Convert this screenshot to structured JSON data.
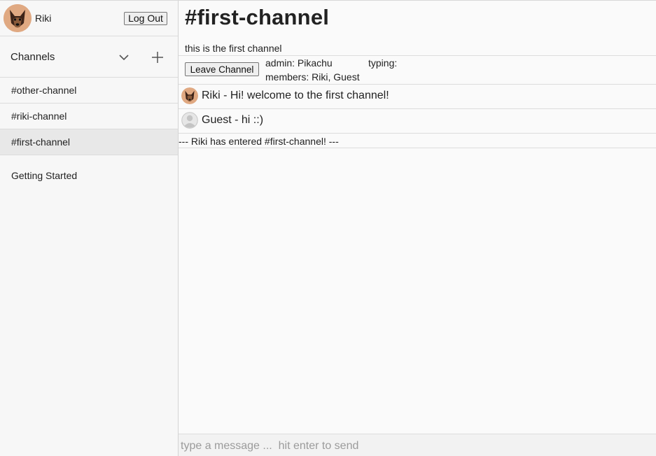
{
  "user": {
    "name": "Riki",
    "avatar_icon": "dog-avatar-icon"
  },
  "logout_label": "Log Out",
  "channels": {
    "title": "Channels",
    "items": [
      {
        "label": "#other-channel",
        "active": false
      },
      {
        "label": "#riki-channel",
        "active": false
      },
      {
        "label": "#first-channel",
        "active": true
      }
    ]
  },
  "getting_started": "Getting Started",
  "channel": {
    "title": "#first-channel",
    "description": "this is the first channel",
    "leave_label": "Leave Channel",
    "admin": "admin: Pikachu",
    "typing": "typing:",
    "members": "members: Riki, Guest"
  },
  "messages": [
    {
      "text": "Riki - Hi! welcome to the first channel!",
      "avatar_icon": "dog-avatar-icon"
    },
    {
      "text": "Guest - hi ::)",
      "avatar_icon": "default-user-icon"
    }
  ],
  "system_message": "--- Riki has entered #first-channel! ---",
  "input": {
    "placeholder": "type a message ...  hit enter to send"
  }
}
